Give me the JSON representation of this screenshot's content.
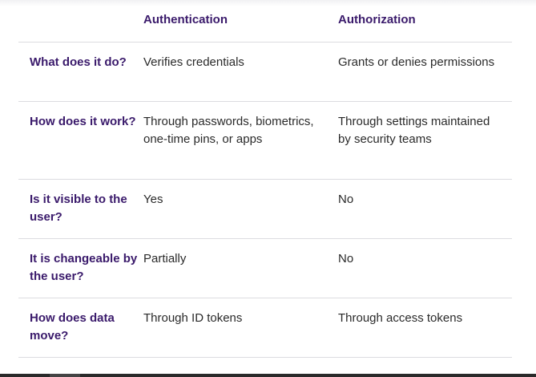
{
  "table": {
    "headers": [
      "",
      "Authentication",
      "Authorization"
    ],
    "rows": [
      {
        "question": "What does it do?",
        "authentication": "Verifies credentials",
        "authorization": "Grants or denies permissions"
      },
      {
        "question": "How does it work?",
        "authentication": "Through passwords, biometrics, one-time pins, or apps",
        "authorization": "Through settings maintained by security teams"
      },
      {
        "question": "Is it visible to the user?",
        "authentication": "Yes",
        "authorization": "No"
      },
      {
        "question": "It is changeable by the user?",
        "authentication": "Partially",
        "authorization": "No"
      },
      {
        "question": "How does data move?",
        "authentication": "Through ID tokens",
        "authorization": "Through access tokens"
      }
    ]
  },
  "colors": {
    "heading": "#3a1a6b",
    "text": "#2a2a2a",
    "divider": "#dcdce0"
  }
}
